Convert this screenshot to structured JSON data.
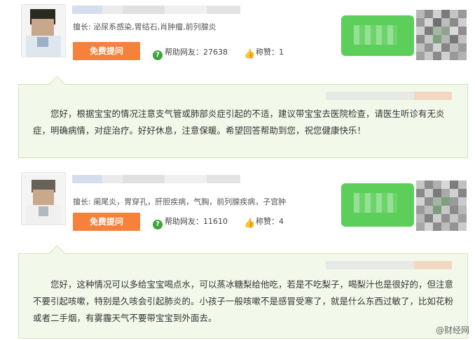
{
  "colors": {
    "accent_orange": "#f5813a",
    "green": "#5ccf5a",
    "answer_bg": "#f3f9ea",
    "answer_border": "#cfe4b8"
  },
  "doctors": [
    {
      "specialty": "擅长: 泌尿系感染,胃结石,肖肿瘤,前列腺炎",
      "ask_label": "免费提问",
      "help_label": "帮助网友：27638",
      "praise_label": "称赞：1",
      "answer": "您好，根据宝宝的情况注意支气管或肺部炎症引起的不适，建议带宝宝去医院检查，请医生听诊有无炎症，明确病情，对症治疗。好好休息，注意保暖。希望回答帮助到您，祝您健康快乐！"
    },
    {
      "specialty": "擅长: 阑尾炎，胃穿孔，肝胆疾病，气胸，前列腺疾病，子宫肿",
      "ask_label": "免费提问",
      "help_label": "帮助网友：11610",
      "praise_label": "称赞：4",
      "answer": "您好，这种情况可以多给宝宝喝点水，可以蒸冰糖梨给他吃，若是不吃梨子，喝梨汁也是很好的，但注意不要引起咳嗽，特别是久咳会引起肺炎的。小孩子一般咳嗽不是感冒受寒了，就是什么东西过敏了，比如花粉或者二手烟，有雾霾天气不要带宝宝到外面去。"
    }
  ],
  "icons": {
    "help": "help-circle-icon",
    "praise": "thumbs-up-icon"
  },
  "watermark": "@财经网"
}
